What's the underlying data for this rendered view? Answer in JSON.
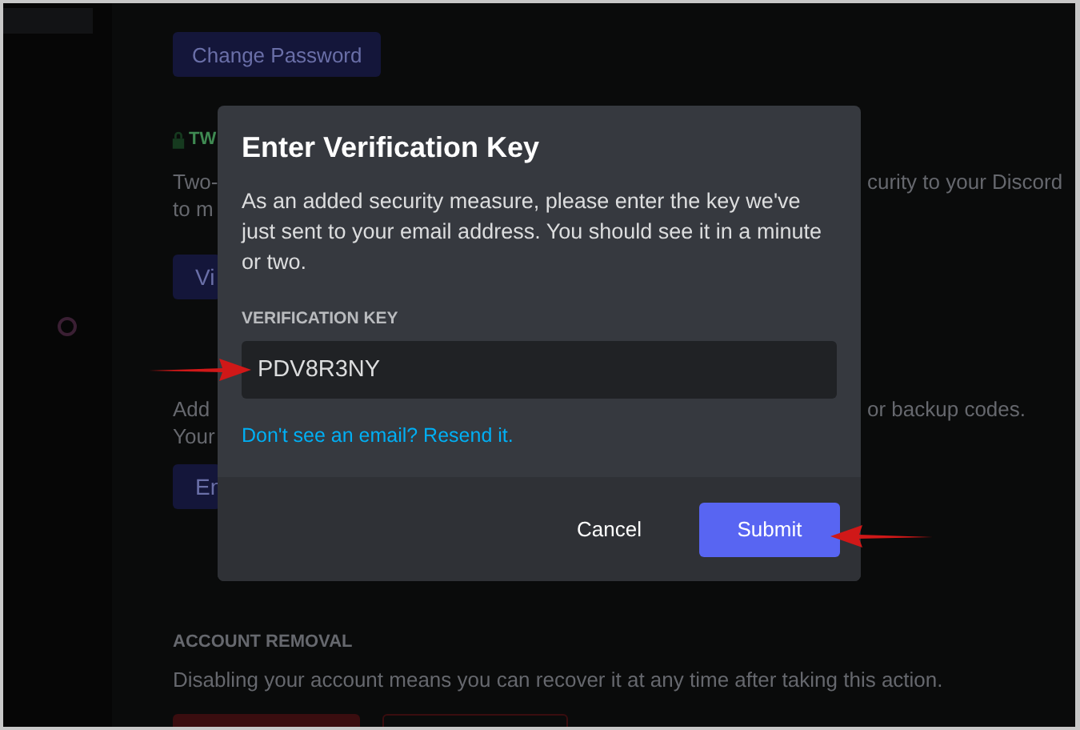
{
  "settings_page": {
    "change_password_button": "Change Password",
    "two_factor_heading": "TW",
    "two_factor_text": [
      "Two-",
      "to m"
    ],
    "two_factor_text_right": "curity to your Discord",
    "view_button": "Vi",
    "backup_text": [
      "Add ",
      "Your "
    ],
    "backup_text_right": "or backup codes.",
    "enable_button": "En",
    "account_removal_heading": "ACCOUNT REMOVAL",
    "account_removal_text": "Disabling your account means you can recover it at any time after taking this action."
  },
  "dialog": {
    "title": "Enter Verification Key",
    "message": "As an added security measure, please enter the key we've just sent to your email address. You should see it in a minute or two.",
    "field_label": "VERIFICATION KEY",
    "field_value": "PDV8R3NY",
    "resend_link": "Don't see an email? Resend it.",
    "buttons": [
      {
        "label": "Cancel",
        "kind": "secondary"
      },
      {
        "label": "Submit",
        "kind": "primary"
      }
    ]
  }
}
